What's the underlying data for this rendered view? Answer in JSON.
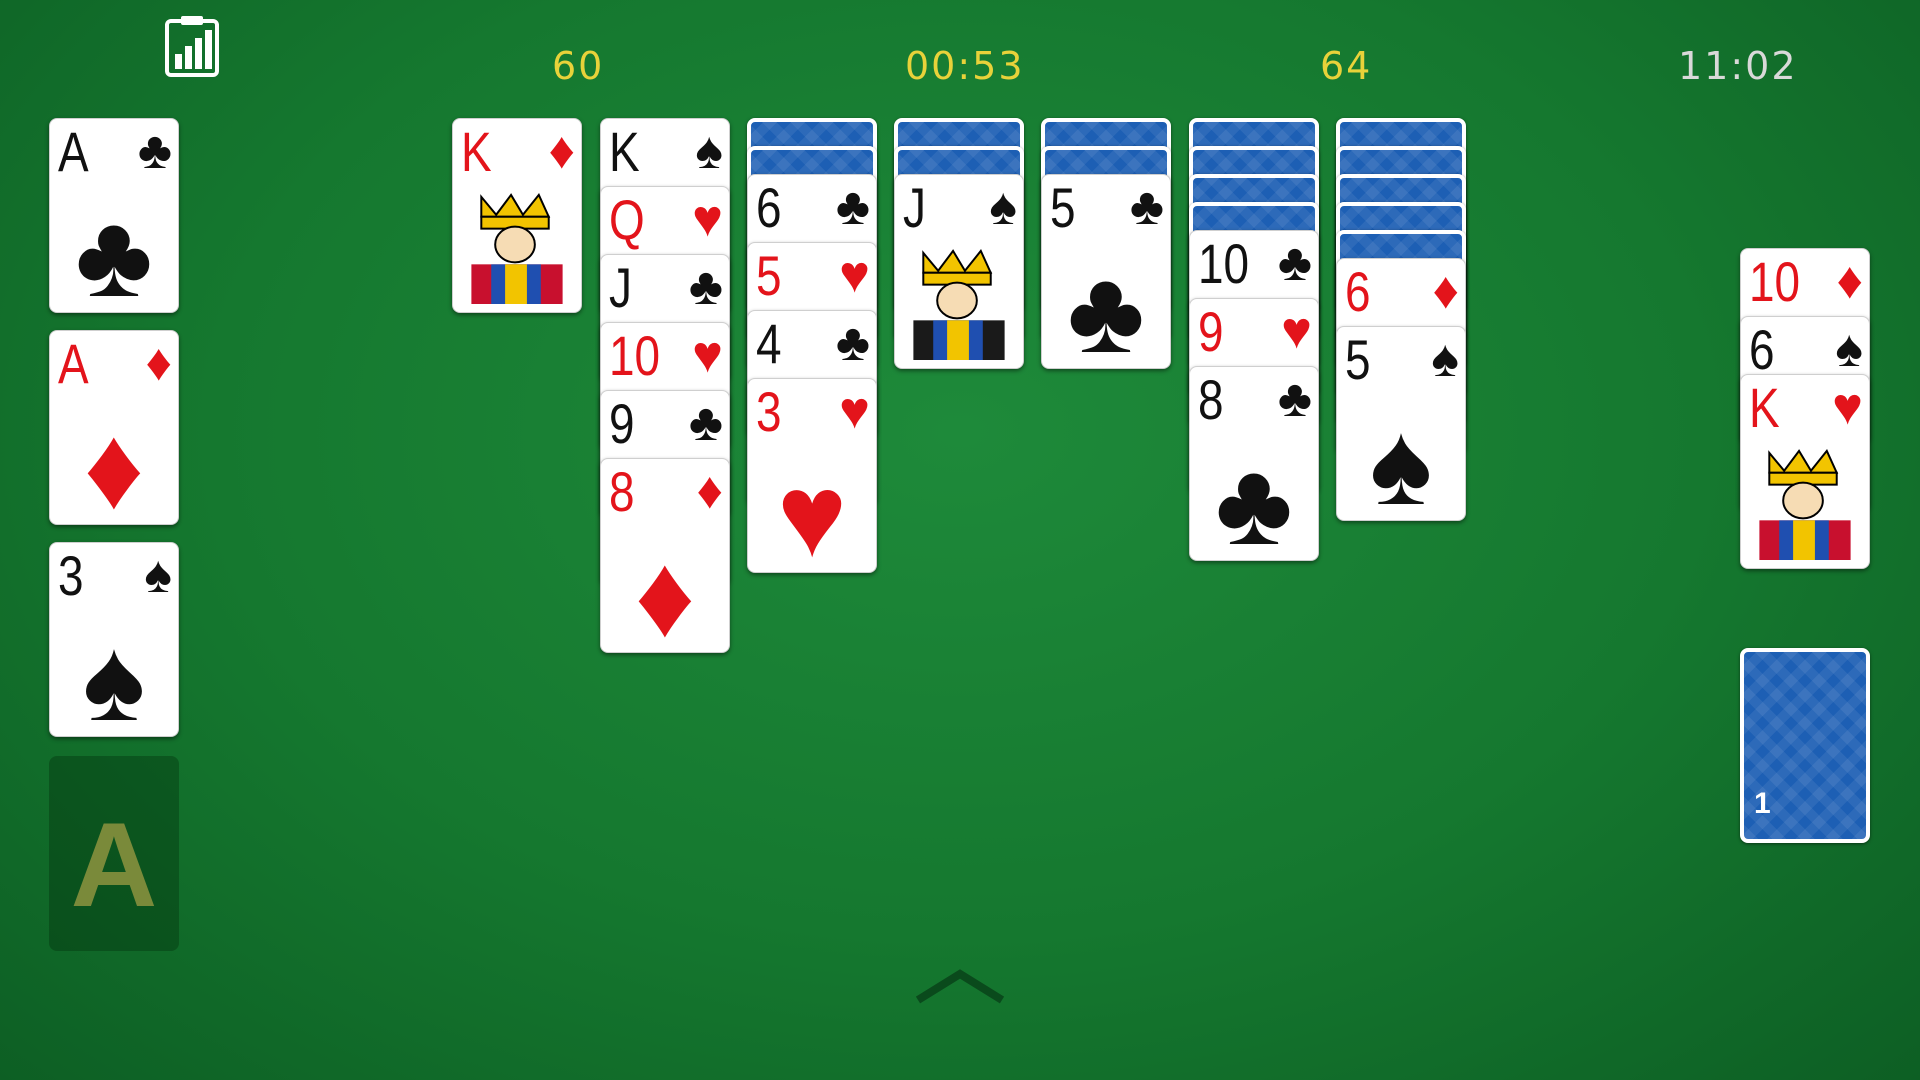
{
  "hud": {
    "score": "60",
    "timer": "00:53",
    "moves": "64",
    "clock": "11:02"
  },
  "icons": {
    "stats": "stats-icon",
    "expand": "chevron-up-icon"
  },
  "colors": {
    "felt": "#15782f",
    "hud_yellow": "#e8d23a",
    "red_suit": "#e3141b",
    "card_back": "#1d5fb4"
  },
  "foundations": [
    {
      "rank": "A",
      "suit": "♣",
      "color": "black"
    },
    {
      "rank": "A",
      "suit": "♦",
      "color": "red"
    },
    {
      "rank": "3",
      "suit": "♠",
      "color": "black"
    },
    {
      "empty_label": "A"
    }
  ],
  "tableau": [
    {
      "hidden": 0,
      "cards": [
        {
          "rank": "K",
          "suit": "♦",
          "color": "red",
          "face": true
        }
      ]
    },
    {
      "hidden": 0,
      "cards": [
        {
          "rank": "K",
          "suit": "♠",
          "color": "black"
        },
        {
          "rank": "Q",
          "suit": "♥",
          "color": "red"
        },
        {
          "rank": "J",
          "suit": "♣",
          "color": "black"
        },
        {
          "rank": "10",
          "suit": "♥",
          "color": "red"
        },
        {
          "rank": "9",
          "suit": "♣",
          "color": "black"
        },
        {
          "rank": "8",
          "suit": "♦",
          "color": "red"
        }
      ]
    },
    {
      "hidden": 2,
      "cards": [
        {
          "rank": "6",
          "suit": "♣",
          "color": "black"
        },
        {
          "rank": "5",
          "suit": "♥",
          "color": "red"
        },
        {
          "rank": "4",
          "suit": "♣",
          "color": "black"
        },
        {
          "rank": "3",
          "suit": "♥",
          "color": "red"
        }
      ]
    },
    {
      "hidden": 2,
      "cards": [
        {
          "rank": "J",
          "suit": "♠",
          "color": "black",
          "face": true
        }
      ]
    },
    {
      "hidden": 2,
      "cards": [
        {
          "rank": "5",
          "suit": "♣",
          "color": "black"
        }
      ]
    },
    {
      "hidden": 4,
      "cards": [
        {
          "rank": "10",
          "suit": "♣",
          "color": "black"
        },
        {
          "rank": "9",
          "suit": "♥",
          "color": "red"
        },
        {
          "rank": "8",
          "suit": "♣",
          "color": "black"
        }
      ]
    },
    {
      "hidden": 5,
      "cards": [
        {
          "rank": "6",
          "suit": "♦",
          "color": "red"
        },
        {
          "rank": "5",
          "suit": "♠",
          "color": "black"
        }
      ]
    }
  ],
  "waste": [
    {
      "rank": "10",
      "suit": "♦",
      "color": "red"
    },
    {
      "rank": "6",
      "suit": "♠",
      "color": "black"
    },
    {
      "rank": "K",
      "suit": "♥",
      "color": "red",
      "face": true
    }
  ],
  "stock": {
    "count": "1"
  }
}
